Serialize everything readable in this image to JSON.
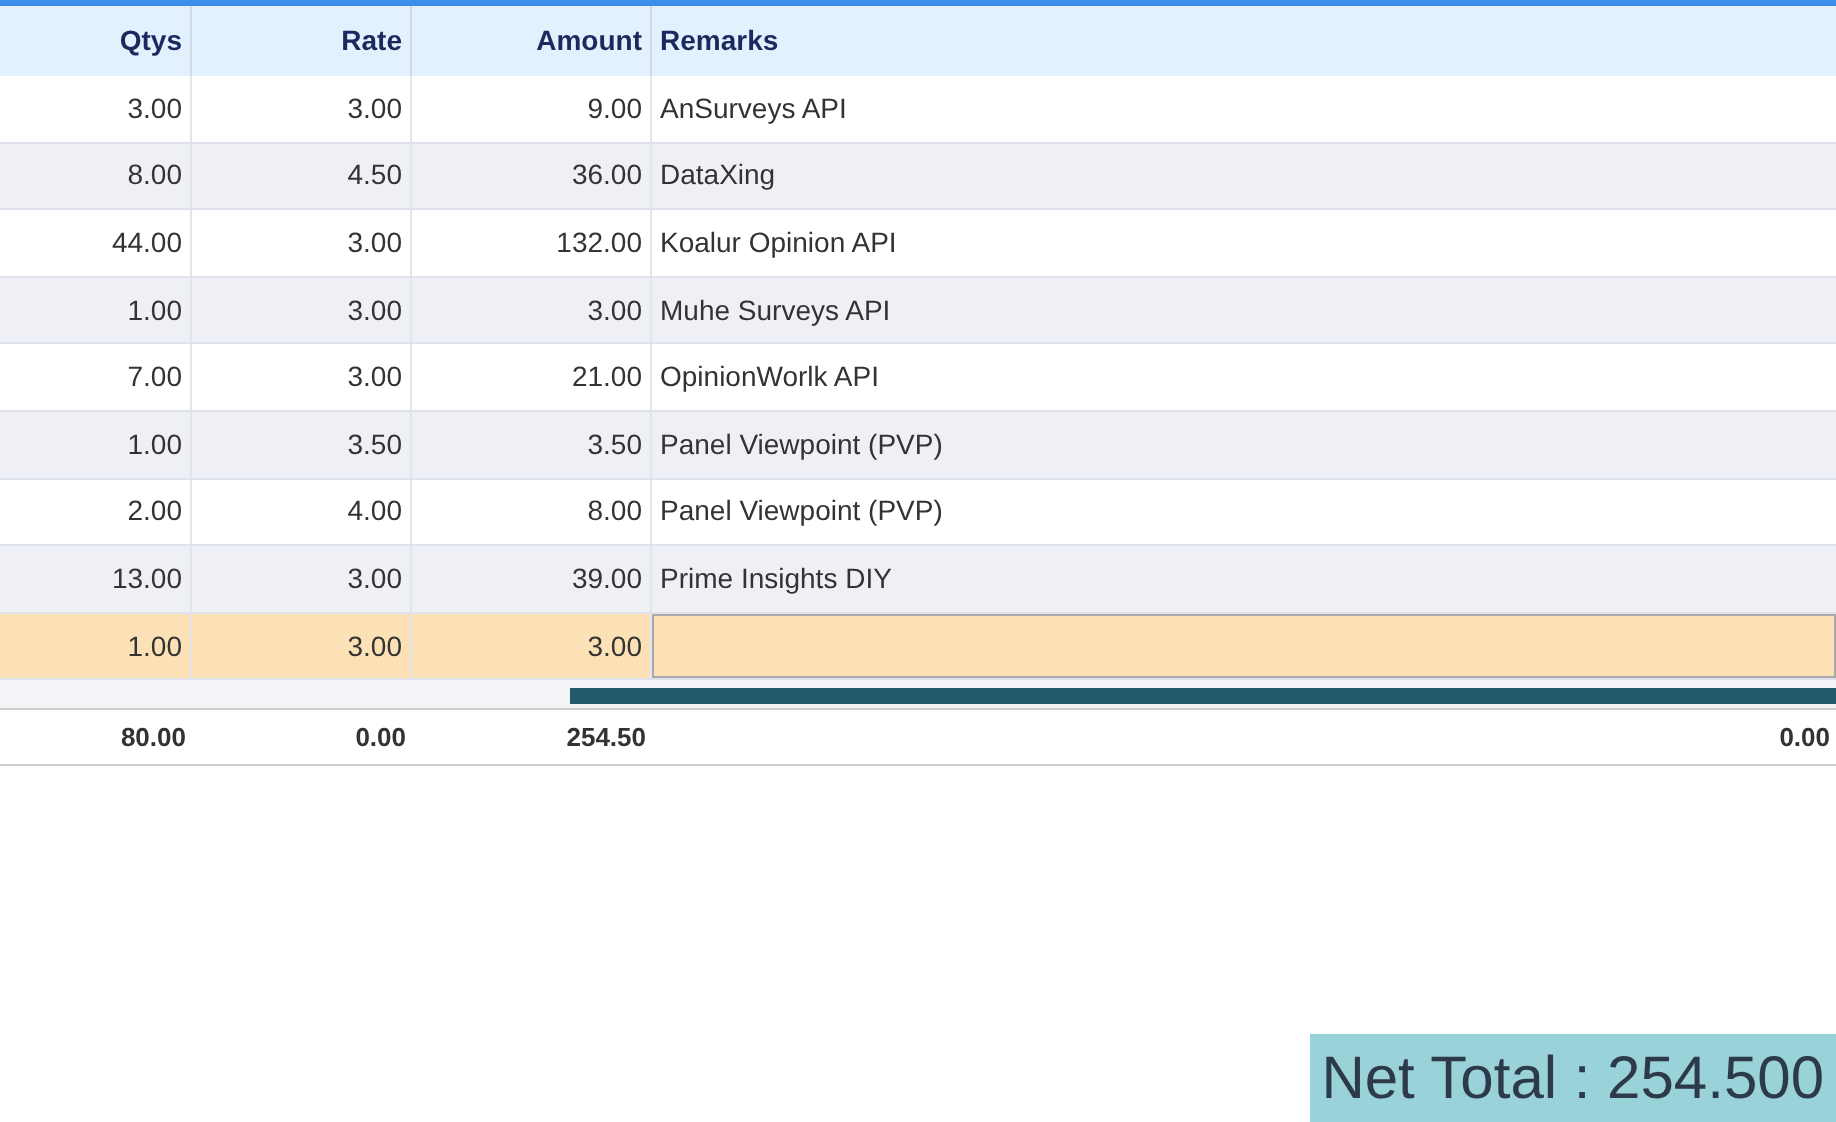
{
  "table": {
    "columns": [
      "Qtys",
      "Rate",
      "Amount",
      "Remarks"
    ],
    "rows": [
      {
        "qtys": "3.00",
        "rate": "3.00",
        "amount": "9.00",
        "remarks": "AnSurveys API",
        "selected": false
      },
      {
        "qtys": "8.00",
        "rate": "4.50",
        "amount": "36.00",
        "remarks": "DataXing",
        "selected": false
      },
      {
        "qtys": "44.00",
        "rate": "3.00",
        "amount": "132.00",
        "remarks": "Koalur Opinion API",
        "selected": false
      },
      {
        "qtys": "1.00",
        "rate": "3.00",
        "amount": "3.00",
        "remarks": "Muhe Surveys API",
        "selected": false
      },
      {
        "qtys": "7.00",
        "rate": "3.00",
        "amount": "21.00",
        "remarks": "OpinionWorlk API",
        "selected": false
      },
      {
        "qtys": "1.00",
        "rate": "3.50",
        "amount": "3.50",
        "remarks": "Panel Viewpoint (PVP)",
        "selected": false
      },
      {
        "qtys": "2.00",
        "rate": "4.00",
        "amount": "8.00",
        "remarks": "Panel Viewpoint (PVP)",
        "selected": false
      },
      {
        "qtys": "13.00",
        "rate": "3.00",
        "amount": "39.00",
        "remarks": "Prime Insights DIY",
        "selected": false
      },
      {
        "qtys": "1.00",
        "rate": "3.00",
        "amount": "3.00",
        "selected": true
      }
    ],
    "totals": [
      "80.00",
      "0.00",
      "254.50",
      "0.00"
    ]
  },
  "net_total": "Net Total : 254.500"
}
